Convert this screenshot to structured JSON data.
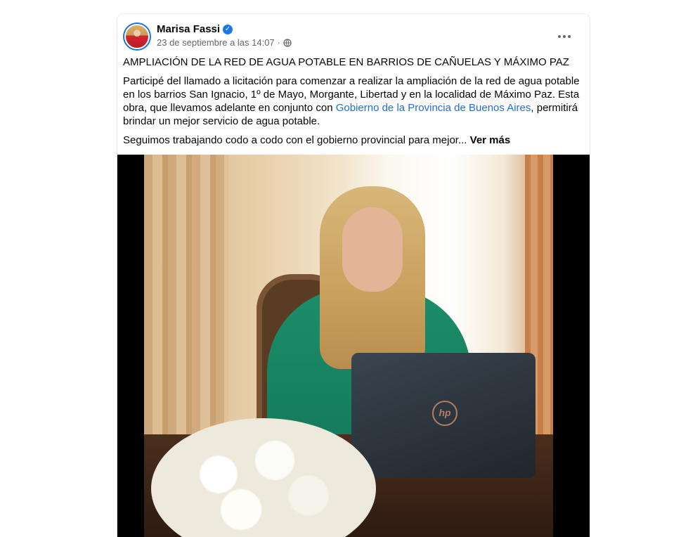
{
  "post": {
    "author": "Marisa Fassi",
    "timestamp": "23 de septiembre a las 14:07",
    "separator": "·",
    "privacy_icon": "globe-icon",
    "verified_icon": "verified-badge-icon",
    "more_icon": "more-options-icon",
    "title": "AMPLIACIÓN DE LA RED DE AGUA POTABLE EN BARRIOS DE CAÑUELAS Y MÁXIMO PAZ",
    "body_part1": "Participé del llamado a licitación para comenzar a realizar la ampliación de la red de agua potable en los barrios San Ignacio, 1º de Mayo, Morgante, Libertad y en la localidad de Máximo Paz. Esta obra, que llevamos adelante en conjunto con ",
    "body_link": "Gobierno de la Provincia de Buenos Aires",
    "body_part2": ", permitirá brindar un mejor servicio de agua potable.",
    "body_second": "Seguimos trabajando codo a codo con el gobierno provincial para mejor...",
    "see_more": "Ver más",
    "laptop_logo": "hp"
  },
  "colors": {
    "link": "#216fdb",
    "verified": "#1877f2",
    "meta_text": "#65676b"
  }
}
